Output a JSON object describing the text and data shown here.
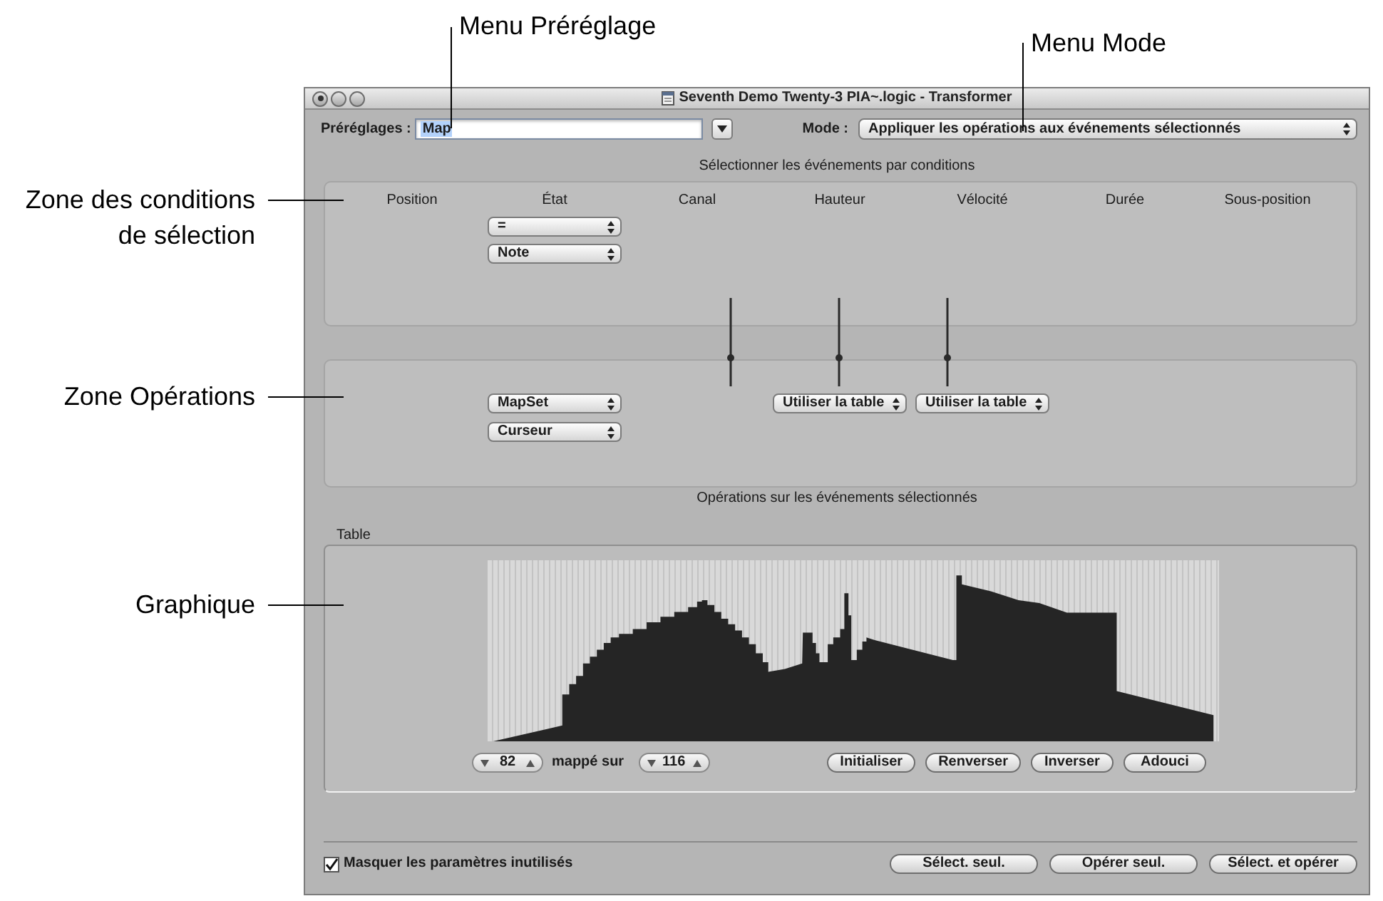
{
  "callouts": [
    {
      "kind": "top",
      "text": "Menu Préréglage"
    },
    {
      "kind": "top",
      "text": "Menu Mode"
    },
    {
      "kind": "left",
      "text": "Zone des conditions\nde sélection"
    },
    {
      "kind": "left",
      "text": "Zone Opérations"
    },
    {
      "kind": "left",
      "text": "Graphique"
    }
  ],
  "window": {
    "title": "Seventh Demo Twenty-3 PIA~.logic - Transformer"
  },
  "presets": {
    "label": "Préréglages :",
    "value": "Map",
    "text_selected": true
  },
  "mode": {
    "label": "Mode :",
    "value": "Appliquer les opérations aux événements sélectionnés"
  },
  "conditions": {
    "title": "Sélectionner les événements par conditions",
    "columns": [
      {
        "header": "Position"
      },
      {
        "header": "État",
        "condition_popups": [
          "=",
          "Note"
        ],
        "operation_popups": [
          "MapSet",
          "Curseur"
        ]
      },
      {
        "header": "Canal"
      },
      {
        "header": "Hauteur",
        "operation_popups": [
          "Utiliser la table"
        ]
      },
      {
        "header": "Vélocité",
        "operation_popups": [
          "Utiliser la table"
        ]
      },
      {
        "header": "Durée"
      },
      {
        "header": "Sous-position"
      }
    ]
  },
  "operations": {
    "title": "Opérations sur les événements sélectionnés"
  },
  "table": {
    "label": "Table",
    "source_value": "82",
    "mapped_label": "mappé sur",
    "target_value": "116",
    "buttons": [
      "Initialiser",
      "Renverser",
      "Inverser",
      "Adouci"
    ]
  },
  "footer": {
    "checkbox": {
      "label": "Masquer les paramètres inutilisés",
      "checked": true
    },
    "buttons": [
      "Sélect. seul.",
      "Opérer seul.",
      "Sélect. et opérer"
    ]
  }
}
